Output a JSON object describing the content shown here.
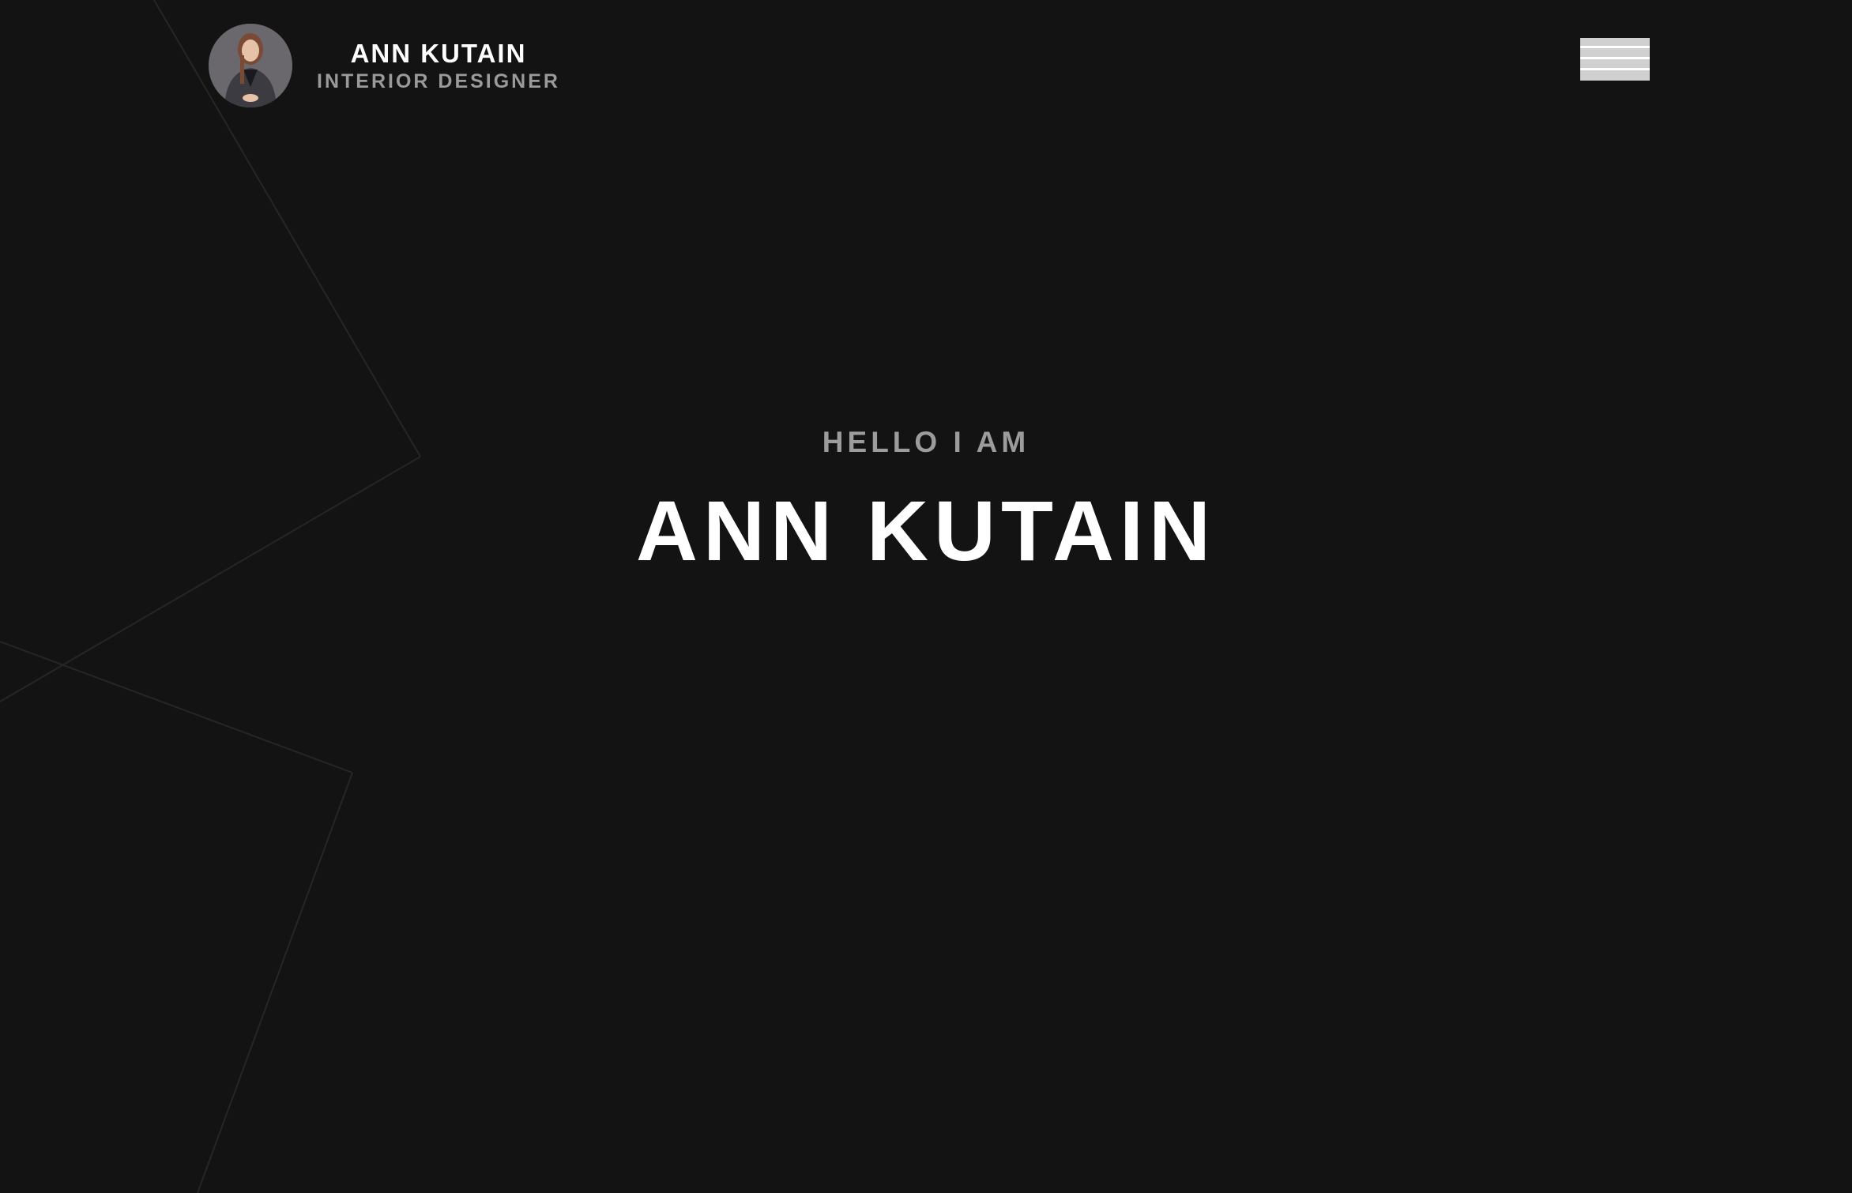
{
  "header": {
    "name": "ANN KUTAIN",
    "role": "INTERIOR DESIGNER",
    "avatar_icon": "profile-photo",
    "menu_icon": "hamburger-menu-icon"
  },
  "hero": {
    "greeting": "HELLO I AM",
    "name": "ANN KUTAIN"
  },
  "colors": {
    "background": "#131313",
    "primary_text": "#ffffff",
    "secondary_text": "#9c9c9c",
    "menu_button": "#d0d0d0"
  }
}
